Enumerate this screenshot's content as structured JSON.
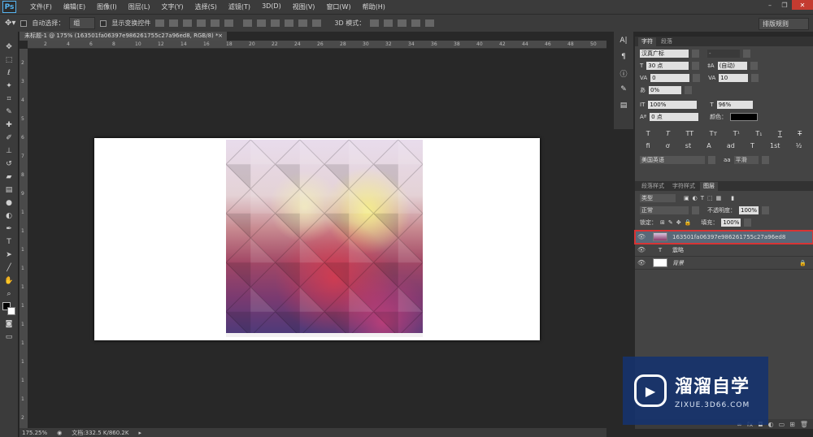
{
  "app": {
    "logo": "Ps"
  },
  "menubar": {
    "items": [
      "文件(F)",
      "编辑(E)",
      "图像(I)",
      "图层(L)",
      "文字(Y)",
      "选择(S)",
      "滤镜(T)",
      "3D(D)",
      "视图(V)",
      "窗口(W)",
      "帮助(H)"
    ]
  },
  "options": {
    "auto_select_label": "自动选择：",
    "auto_select_value": "组",
    "show_transform_label": "显示变换控件",
    "mode_3d_label": "3D 模式：",
    "workspace": "排版规则"
  },
  "document": {
    "tab_title": "未标题-1 @ 175% (163501fa06397e986261755c27a96ed8, RGB/8) *",
    "tab_close": "×"
  },
  "ruler_top": [
    "2",
    "4",
    "6",
    "8",
    "10",
    "12",
    "14",
    "16",
    "18",
    "20",
    "22",
    "24",
    "26",
    "28",
    "30",
    "32",
    "34",
    "36",
    "38",
    "40",
    "42",
    "44",
    "46",
    "48",
    "50"
  ],
  "ruler_left": [
    "2",
    "3",
    "4",
    "5",
    "6",
    "7",
    "8",
    "9",
    "1",
    "1",
    "1",
    "1",
    "1",
    "1",
    "1",
    "1",
    "1",
    "1",
    "1",
    "2"
  ],
  "status": {
    "zoom": "175.25%",
    "doc": "文档:332.5 K/860.2K"
  },
  "character": {
    "tabs": [
      "字符",
      "段落"
    ],
    "font_family": "汉真广标",
    "font_style": "-",
    "font_size": "30 点",
    "leading": "(自动)",
    "kerning": "0",
    "tracking": "10",
    "tsume": "0%",
    "vscale": "100%",
    "hscale": "96%",
    "baseline": "0 点",
    "color_label": "颜色：",
    "color": "#000000",
    "language": "美国英语",
    "antialias_label": "aa",
    "antialias": "平滑"
  },
  "layers": {
    "tabs": [
      "段落样式",
      "字符样式",
      "图层"
    ],
    "filter": "类型",
    "blend_mode": "正常",
    "opacity_label": "不透明度：",
    "opacity": "100%",
    "lock_label": "锁定：",
    "fill_label": "填充：",
    "fill": "100%",
    "items": [
      {
        "name": "163501fa06397e986261755c27a96ed8",
        "selected": true
      },
      {
        "name": "震略",
        "type": "text"
      },
      {
        "name": "背景",
        "locked": true
      }
    ]
  },
  "watermark": {
    "title": "溜溜自学",
    "subtitle": "ZIXUE.3D66.COM"
  },
  "colors": {
    "panel": "#444444",
    "selected_layer": "#596878",
    "highlight": "#d83434"
  }
}
